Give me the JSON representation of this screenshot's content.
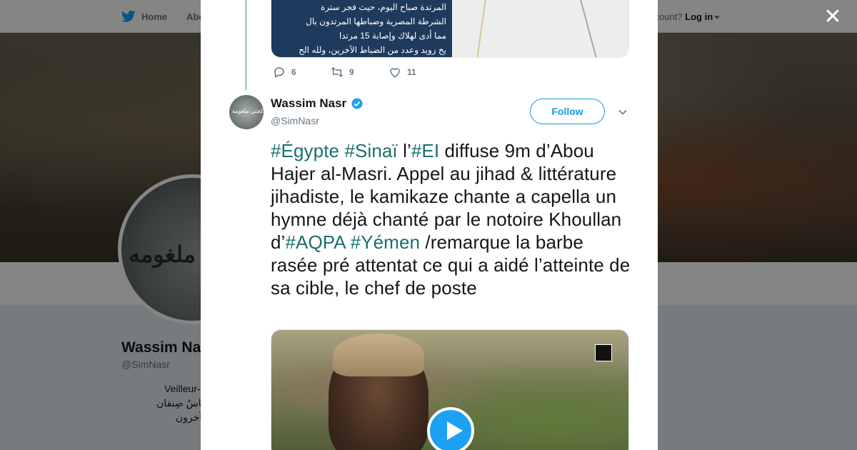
{
  "nav": {
    "home_label": "Home",
    "about_label": "Abo",
    "account_prompt": "ccount?",
    "login_label": "Log in"
  },
  "profile": {
    "name": "Wassim Na",
    "handle": "@SimNasr",
    "bio_line1": "Veilleur-A",
    "bio_line2": "ـاسٌ صِنفان:",
    "bio_line3": "وآخرون",
    "avatar_text": "ي ملغومه"
  },
  "modal": {
    "close_icon": "close-icon",
    "prev_media": {
      "lines": [
        "المرتدة صباح اليوم، حيث فجر سترة",
        "الشرطة المصرية وضباطها المرتدون بال",
        "مما أدى لهلاك وإصابة 15 مرتدا",
        "يخ زويد وعدد من الضباط الآخرين، ولله الح"
      ]
    },
    "prev_actions": {
      "reply_count": "6",
      "retweet_count": "9",
      "like_count": "11"
    },
    "tweet": {
      "author_name": "Wassim Nasr",
      "author_handle": "@SimNasr",
      "avatar_text": "تاكجتي ملغومة",
      "follow_label": "Follow",
      "text_parts": {
        "h1": "#Égypte",
        "h2": "#Sinaï",
        "t1": " l’",
        "h3": "#EI",
        "t2": " diffuse 9m d’Abou Hajer al-Masri. Appel au jihad & littérature jihadiste, le kamikaze chante a capella un hymne déjà chanté par le notoire Khoullan d’",
        "h4": "#AQPA",
        "h5": "#Yémen",
        "t3": " /remarque la barbe rasée pré attentat ce qui a aidé l’atteinte de sa cible, le chef de poste"
      }
    }
  },
  "colors": {
    "link": "#1b6e6e",
    "accent": "#1b95e0",
    "play": "#1da1f2"
  }
}
